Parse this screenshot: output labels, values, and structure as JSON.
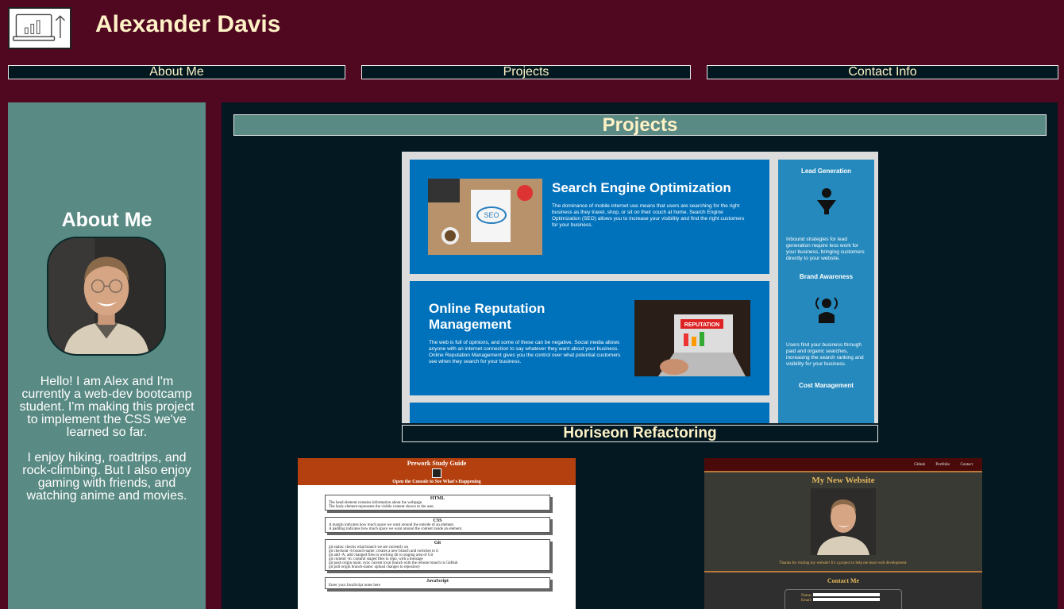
{
  "header": {
    "title": "Alexander Davis",
    "logo_icon": "laptop-chart-icon"
  },
  "nav": {
    "items": [
      {
        "label": "About Me"
      },
      {
        "label": "Projects"
      },
      {
        "label": "Contact Info"
      }
    ]
  },
  "sidebar": {
    "heading": "About Me",
    "bio": [
      "Hello! I am Alex and I'm currently a web-dev bootcamp student. I'm making this project to implement the CSS we've learned so far.",
      "I enjoy hiking, roadtrips, and rock-climbing. But I also enjoy gaming with friends, and watching anime and movies."
    ]
  },
  "main": {
    "heading": "Projects",
    "featured": {
      "caption": "Horiseon Refactoring",
      "cards": [
        {
          "title": "Search Engine Optimization",
          "text": "The dominance of mobile internet use means that users are searching for the right business as they travel, shop, or sit on their couch at home. Search Engine Optimization (SEO) allows you to increase your visibility and find the right customers for your business."
        },
        {
          "title": "Online Reputation Management",
          "text": "The web is full of opinions, and some of these can be negative. Social media allows anyone with an internet connection to say whatever they want about your business. Online Reputation Management gives you the control over what potential customers see when they search for your business."
        }
      ],
      "side": [
        {
          "title": "Lead Generation",
          "text": "Inbound strategies for lead generation require less work for your business, bringing customers directly to your website."
        },
        {
          "title": "Brand Awareness",
          "text": "Users find your business through paid and organic searches, increasing the search ranking and visibility for your business."
        },
        {
          "title": "Cost Management",
          "text": ""
        }
      ],
      "img_labels": {
        "seo": "SEO",
        "reputation": "REPUTATION"
      }
    },
    "prework": {
      "title": "Prework Study Guide",
      "subtitle": "Open the Console to See What's Happening",
      "sections": [
        {
          "title": "HTML",
          "items": [
            "The head element contains information about the webpage.",
            "The body element represents the visible content shown to the user."
          ]
        },
        {
          "title": "CSS",
          "items": [
            "A margin indicates how much space we want around the outside of an element.",
            "A padding indicates how much space we want around the content inside an element."
          ]
        },
        {
          "title": "Git",
          "items": [
            "git status: checks what branch we are currently on",
            "git checkout -b branch-name: creates a new branch and switches to it",
            "git add -A: add changed files in working dir to staging area of Git",
            "git commit -m: commit staged files to repo, with a message",
            "git push origin main: sync current local branch with the remote branch in GitHub",
            "git pull origin branch-name: upload changes to repository"
          ]
        },
        {
          "title": "JavaScript",
          "items": [
            "Enter your JavaScript notes here"
          ]
        }
      ]
    },
    "site": {
      "nav": [
        "Github",
        "Portfolio",
        "Contact"
      ],
      "title": "My New Website",
      "tagline": "Thanks for visiting my website! It's a project to help me learn web development.",
      "contact_title": "Contact Me",
      "fields": [
        "Name:",
        "Email:"
      ]
    }
  },
  "colors": {
    "background": "#4f0820",
    "panel": "#5a8a84",
    "main_bg": "#031820",
    "accent_text": "#fff2c6",
    "horiseon_blue": "#0072bc"
  }
}
